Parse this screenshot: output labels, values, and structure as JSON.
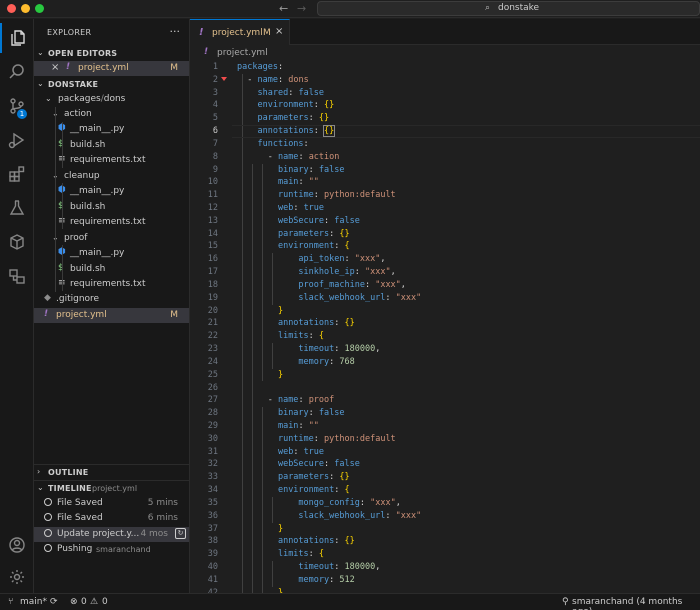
{
  "window": {
    "search_text": "donstake"
  },
  "activity": {
    "scm_badge": "1"
  },
  "sidebar": {
    "title": "EXPLORER",
    "more": "···",
    "open_editors_label": "OPEN EDITORS",
    "open_editor": {
      "name": "project.yml",
      "status": "M"
    },
    "root_label": "DONSTAKE",
    "folder_packages": "packages",
    "folder_sep": "/",
    "folder_dons": "dons",
    "tree": [
      {
        "name": "action",
        "kind": "folder",
        "depth": 2
      },
      {
        "name": "__main__.py",
        "kind": "py",
        "depth": 3
      },
      {
        "name": "build.sh",
        "kind": "sh",
        "depth": 3
      },
      {
        "name": "requirements.txt",
        "kind": "txt",
        "depth": 3
      },
      {
        "name": "cleanup",
        "kind": "folder",
        "depth": 2
      },
      {
        "name": "__main__.py",
        "kind": "py",
        "depth": 3
      },
      {
        "name": "build.sh",
        "kind": "sh",
        "depth": 3
      },
      {
        "name": "requirements.txt",
        "kind": "txt",
        "depth": 3
      },
      {
        "name": "proof",
        "kind": "folder",
        "depth": 2
      },
      {
        "name": "__main__.py",
        "kind": "py",
        "depth": 3
      },
      {
        "name": "build.sh",
        "kind": "sh",
        "depth": 3
      },
      {
        "name": "requirements.txt",
        "kind": "txt",
        "depth": 3
      },
      {
        "name": ".gitignore",
        "kind": "git",
        "depth": 1
      },
      {
        "name": "project.yml",
        "kind": "yml",
        "depth": 1,
        "status": "M"
      }
    ],
    "outline_label": "OUTLINE",
    "timeline_label": "TIMELINE",
    "timeline_file": "project.yml",
    "timeline": [
      {
        "label": "File Saved",
        "time": "5 mins"
      },
      {
        "label": "File Saved",
        "time": "6 mins"
      },
      {
        "label": "Update project.y...",
        "time": "4 mos"
      },
      {
        "label": "Pushing",
        "author": "smaranchand"
      }
    ]
  },
  "editor": {
    "tab_label": "project.yml",
    "tab_status": "M",
    "breadcrumb": "project.yml",
    "current_line": 6,
    "lines": [
      [
        [
          "k",
          "packages"
        ],
        [
          "p",
          ":"
        ]
      ],
      [
        [
          "p",
          "  - "
        ],
        [
          "k",
          "name"
        ],
        [
          "p",
          ": "
        ],
        [
          "s",
          "dons"
        ]
      ],
      [
        [
          "p",
          "    "
        ],
        [
          "k",
          "shared"
        ],
        [
          "p",
          ": "
        ],
        [
          "b",
          "false"
        ]
      ],
      [
        [
          "p",
          "    "
        ],
        [
          "k",
          "environment"
        ],
        [
          "p",
          ": "
        ],
        [
          "br",
          "{}"
        ]
      ],
      [
        [
          "p",
          "    "
        ],
        [
          "k",
          "parameters"
        ],
        [
          "p",
          ": "
        ],
        [
          "br",
          "{}"
        ]
      ],
      [
        [
          "p",
          "    "
        ],
        [
          "k",
          "annotations"
        ],
        [
          "p",
          ": "
        ],
        [
          "brx",
          "{}"
        ]
      ],
      [
        [
          "p",
          "    "
        ],
        [
          "k",
          "functions"
        ],
        [
          "p",
          ":"
        ]
      ],
      [
        [
          "p",
          "      - "
        ],
        [
          "k",
          "name"
        ],
        [
          "p",
          ": "
        ],
        [
          "s",
          "action"
        ]
      ],
      [
        [
          "p",
          "        "
        ],
        [
          "k",
          "binary"
        ],
        [
          "p",
          ": "
        ],
        [
          "b",
          "false"
        ]
      ],
      [
        [
          "p",
          "        "
        ],
        [
          "k",
          "main"
        ],
        [
          "p",
          ": "
        ],
        [
          "s",
          "\"\""
        ]
      ],
      [
        [
          "p",
          "        "
        ],
        [
          "k",
          "runtime"
        ],
        [
          "p",
          ": "
        ],
        [
          "s",
          "python:default"
        ]
      ],
      [
        [
          "p",
          "        "
        ],
        [
          "k",
          "web"
        ],
        [
          "p",
          ": "
        ],
        [
          "b",
          "true"
        ]
      ],
      [
        [
          "p",
          "        "
        ],
        [
          "k",
          "webSecure"
        ],
        [
          "p",
          ": "
        ],
        [
          "b",
          "false"
        ]
      ],
      [
        [
          "p",
          "        "
        ],
        [
          "k",
          "parameters"
        ],
        [
          "p",
          ": "
        ],
        [
          "br",
          "{}"
        ]
      ],
      [
        [
          "p",
          "        "
        ],
        [
          "k",
          "environment"
        ],
        [
          "p",
          ": "
        ],
        [
          "br",
          "{"
        ]
      ],
      [
        [
          "p",
          "            "
        ],
        [
          "k",
          "api_token"
        ],
        [
          "p",
          ": "
        ],
        [
          "s",
          "\"xxx\""
        ],
        [
          "p",
          ","
        ]
      ],
      [
        [
          "p",
          "            "
        ],
        [
          "k",
          "sinkhole_ip"
        ],
        [
          "p",
          ": "
        ],
        [
          "s",
          "\"xxx\""
        ],
        [
          "p",
          ","
        ]
      ],
      [
        [
          "p",
          "            "
        ],
        [
          "k",
          "proof_machine"
        ],
        [
          "p",
          ": "
        ],
        [
          "s",
          "\"xxx\""
        ],
        [
          "p",
          ","
        ]
      ],
      [
        [
          "p",
          "            "
        ],
        [
          "k",
          "slack_webhook_url"
        ],
        [
          "p",
          ": "
        ],
        [
          "s",
          "\"xxx\""
        ]
      ],
      [
        [
          "p",
          "        "
        ],
        [
          "br",
          "}"
        ]
      ],
      [
        [
          "p",
          "        "
        ],
        [
          "k",
          "annotations"
        ],
        [
          "p",
          ": "
        ],
        [
          "br",
          "{}"
        ]
      ],
      [
        [
          "p",
          "        "
        ],
        [
          "k",
          "limits"
        ],
        [
          "p",
          ": "
        ],
        [
          "br",
          "{"
        ]
      ],
      [
        [
          "p",
          "            "
        ],
        [
          "k",
          "timeout"
        ],
        [
          "p",
          ": "
        ],
        [
          "n",
          "180000"
        ],
        [
          "p",
          ","
        ]
      ],
      [
        [
          "p",
          "            "
        ],
        [
          "k",
          "memory"
        ],
        [
          "p",
          ": "
        ],
        [
          "n",
          "768"
        ]
      ],
      [
        [
          "p",
          "        "
        ],
        [
          "br",
          "}"
        ]
      ],
      [
        [
          "p",
          ""
        ]
      ],
      [
        [
          "p",
          "      - "
        ],
        [
          "k",
          "name"
        ],
        [
          "p",
          ": "
        ],
        [
          "s",
          "proof"
        ]
      ],
      [
        [
          "p",
          "        "
        ],
        [
          "k",
          "binary"
        ],
        [
          "p",
          ": "
        ],
        [
          "b",
          "false"
        ]
      ],
      [
        [
          "p",
          "        "
        ],
        [
          "k",
          "main"
        ],
        [
          "p",
          ": "
        ],
        [
          "s",
          "\"\""
        ]
      ],
      [
        [
          "p",
          "        "
        ],
        [
          "k",
          "runtime"
        ],
        [
          "p",
          ": "
        ],
        [
          "s",
          "python:default"
        ]
      ],
      [
        [
          "p",
          "        "
        ],
        [
          "k",
          "web"
        ],
        [
          "p",
          ": "
        ],
        [
          "b",
          "true"
        ]
      ],
      [
        [
          "p",
          "        "
        ],
        [
          "k",
          "webSecure"
        ],
        [
          "p",
          ": "
        ],
        [
          "b",
          "false"
        ]
      ],
      [
        [
          "p",
          "        "
        ],
        [
          "k",
          "parameters"
        ],
        [
          "p",
          ": "
        ],
        [
          "br",
          "{}"
        ]
      ],
      [
        [
          "p",
          "        "
        ],
        [
          "k",
          "environment"
        ],
        [
          "p",
          ": "
        ],
        [
          "br",
          "{"
        ]
      ],
      [
        [
          "p",
          "            "
        ],
        [
          "k",
          "mongo_config"
        ],
        [
          "p",
          ": "
        ],
        [
          "s",
          "\"xxx\""
        ],
        [
          "p",
          ","
        ]
      ],
      [
        [
          "p",
          "            "
        ],
        [
          "k",
          "slack_webhook_url"
        ],
        [
          "p",
          ": "
        ],
        [
          "s",
          "\"xxx\""
        ]
      ],
      [
        [
          "p",
          "        "
        ],
        [
          "br",
          "}"
        ]
      ],
      [
        [
          "p",
          "        "
        ],
        [
          "k",
          "annotations"
        ],
        [
          "p",
          ": "
        ],
        [
          "br",
          "{}"
        ]
      ],
      [
        [
          "p",
          "        "
        ],
        [
          "k",
          "limits"
        ],
        [
          "p",
          ": "
        ],
        [
          "br",
          "{"
        ]
      ],
      [
        [
          "p",
          "            "
        ],
        [
          "k",
          "timeout"
        ],
        [
          "p",
          ": "
        ],
        [
          "n",
          "180000"
        ],
        [
          "p",
          ","
        ]
      ],
      [
        [
          "p",
          "            "
        ],
        [
          "k",
          "memory"
        ],
        [
          "p",
          ": "
        ],
        [
          "n",
          "512"
        ]
      ],
      [
        [
          "p",
          "        "
        ],
        [
          "br",
          "}"
        ]
      ]
    ]
  },
  "statusbar": {
    "branch": "main*",
    "errors": "0",
    "warnings": "0",
    "blame": "smaranchand (4 months ago)"
  },
  "colors": {
    "accent": "#0078d4",
    "modified": "#e2c08d"
  }
}
